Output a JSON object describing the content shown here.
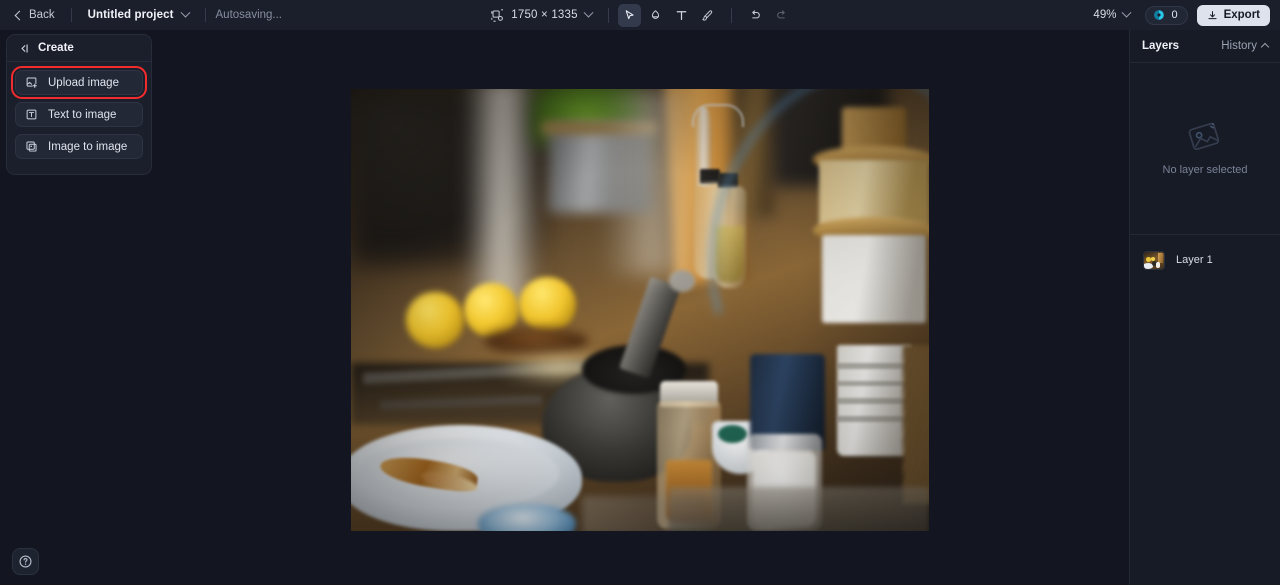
{
  "topbar": {
    "back_label": "Back",
    "project_name": "Untitled project",
    "autosave_status": "Autosaving...",
    "canvas_size": "1750 × 1335",
    "zoom_level": "49%",
    "credits_count": "0",
    "export_label": "Export",
    "icons": {
      "back_chevron": "chevron-left-icon",
      "project_chevron": "chevron-down-icon",
      "resize": "canvas-resize-icon",
      "select": "select-cursor-icon",
      "eraser": "eraser-icon",
      "text": "text-tool-icon",
      "brush": "brush-icon",
      "undo": "undo-icon",
      "redo": "redo-icon",
      "zoom_chevron": "chevron-down-icon",
      "credits": "credits-coin-icon",
      "export": "download-icon"
    },
    "tools": [
      {
        "name": "select-tool",
        "glyph": "select-cursor-icon",
        "active": true,
        "disabled": false
      },
      {
        "name": "eraser-tool",
        "glyph": "eraser-icon",
        "active": false,
        "disabled": false
      },
      {
        "name": "text-tool",
        "glyph": "text-tool-icon",
        "active": false,
        "disabled": false
      },
      {
        "name": "brush-tool",
        "glyph": "brush-icon",
        "active": false,
        "disabled": false
      },
      {
        "name": "undo-button",
        "glyph": "undo-icon",
        "active": false,
        "disabled": false
      },
      {
        "name": "redo-button",
        "glyph": "redo-icon",
        "active": false,
        "disabled": true
      }
    ]
  },
  "left_panel": {
    "title": "Create",
    "collapse_icon": "collapse-panel-icon",
    "items": [
      {
        "label": "Upload image",
        "icon": "image-upload-icon",
        "highlighted": true
      },
      {
        "label": "Text to image",
        "icon": "text-to-image-icon",
        "highlighted": false
      },
      {
        "label": "Image to image",
        "icon": "image-to-image-icon",
        "highlighted": false
      }
    ]
  },
  "right_panel": {
    "tab_layers": "Layers",
    "tab_history": "History",
    "history_chevron": "chevron-up-icon",
    "empty_state_text": "No layer selected",
    "empty_state_icon": "no-layer-image-icon",
    "layers": [
      {
        "name": "Layer 1",
        "thumbnail": "kitchen-photo-thumbnail"
      }
    ]
  },
  "canvas": {
    "image_alt": "Blurred kitchen scene with lemons, mortar and pestle, oil cruets, salt and pepper shakers, white tart dish",
    "selected": false
  },
  "help": {
    "icon": "help-question-icon",
    "label": "Help"
  },
  "colors": {
    "app_background": "#131620",
    "panel_background": "#1b1f2b",
    "topbar_background": "#1b1f2b",
    "right_panel_background": "#171b26",
    "highlight_red": "#f22c2c",
    "credits_accent": "#29c7e8",
    "export_background": "#dde2ec",
    "text_primary": "#f0f2f7",
    "text_muted": "#878ea0"
  }
}
